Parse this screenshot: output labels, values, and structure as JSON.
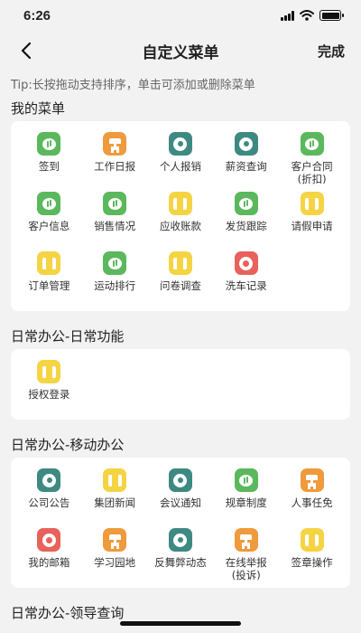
{
  "status": {
    "time": "6:26"
  },
  "nav": {
    "title": "自定义菜单",
    "done": "完成"
  },
  "tip": "Tip:长按拖动支持排序，单击可添加或删除菜单",
  "sections": [
    {
      "title": "我的菜单",
      "items": [
        {
          "label": "签到",
          "icon": "chat-bubble-icon",
          "color": "green"
        },
        {
          "label": "工作日报",
          "icon": "lamp-icon",
          "color": "orange"
        },
        {
          "label": "个人报销",
          "icon": "satellite-dish-icon",
          "color": "teal"
        },
        {
          "label": "薪资查询",
          "icon": "satellite-dish-icon",
          "color": "teal"
        },
        {
          "label": "客户合同\n(折扣)",
          "icon": "chat-bubble-icon",
          "color": "green"
        },
        {
          "label": "客户信息",
          "icon": "chat-bubble-icon",
          "color": "green"
        },
        {
          "label": "销售情况",
          "icon": "chat-bubble-icon",
          "color": "green"
        },
        {
          "label": "应收账款",
          "icon": "film-icon",
          "color": "yellow"
        },
        {
          "label": "发货跟踪",
          "icon": "chat-bubble-icon",
          "color": "green"
        },
        {
          "label": "请假申请",
          "icon": "film-icon",
          "color": "yellow"
        },
        {
          "label": "订单管理",
          "icon": "film-icon",
          "color": "yellow"
        },
        {
          "label": "运动排行",
          "icon": "chat-bubble-icon",
          "color": "green"
        },
        {
          "label": "问卷调查",
          "icon": "film-icon",
          "color": "yellow"
        },
        {
          "label": "洗车记录",
          "icon": "film-reel-icon",
          "color": "red"
        }
      ]
    },
    {
      "title": "日常办公-日常功能",
      "items": [
        {
          "label": "授权登录",
          "icon": "film-icon",
          "color": "yellow"
        }
      ]
    },
    {
      "title": "日常办公-移动办公",
      "items": [
        {
          "label": "公司公告",
          "icon": "satellite-dish-icon",
          "color": "teal"
        },
        {
          "label": "集团新闻",
          "icon": "film-icon",
          "color": "yellow"
        },
        {
          "label": "会议通知",
          "icon": "satellite-dish-icon",
          "color": "teal"
        },
        {
          "label": "规章制度",
          "icon": "chat-bubble-icon",
          "color": "green"
        },
        {
          "label": "人事任免",
          "icon": "lamp-icon",
          "color": "orange"
        },
        {
          "label": "我的邮箱",
          "icon": "film-reel-icon",
          "color": "red"
        },
        {
          "label": "学习园地",
          "icon": "lamp-icon",
          "color": "orange"
        },
        {
          "label": "反舞弊动态",
          "icon": "satellite-dish-icon",
          "color": "teal"
        },
        {
          "label": "在线举报\n(投诉)",
          "icon": "lamp-icon",
          "color": "orange"
        },
        {
          "label": "签章操作",
          "icon": "film-icon",
          "color": "yellow"
        }
      ]
    },
    {
      "title": "日常办公-领导查询",
      "items": []
    }
  ],
  "colors": {
    "green": "#5bb85d",
    "orange": "#ef9a3c",
    "teal": "#3e8a82",
    "yellow": "#f5d444",
    "red": "#e8625b"
  }
}
